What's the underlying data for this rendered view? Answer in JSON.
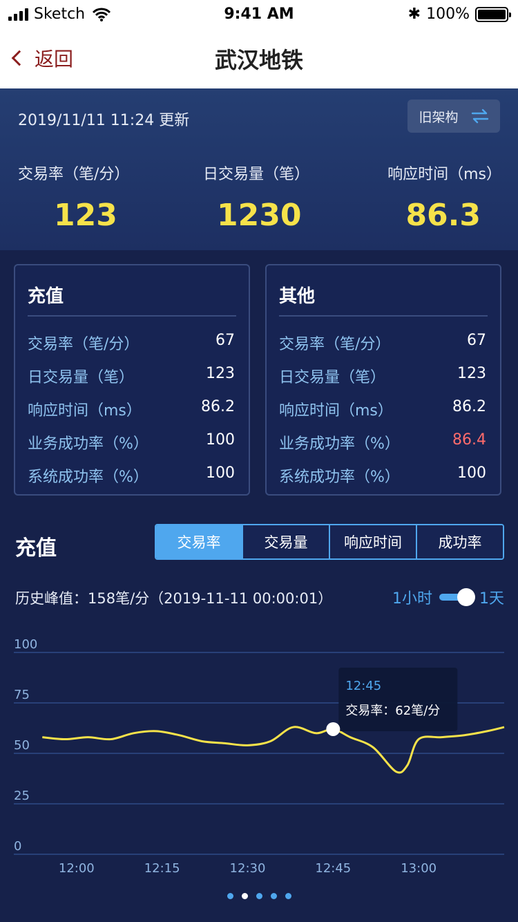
{
  "status_bar": {
    "carrier": "Sketch",
    "time": "9:41 AM",
    "battery": "100%"
  },
  "nav": {
    "back_label": "返回",
    "title": "武汉地铁"
  },
  "summary": {
    "update_text": "2019/11/11   11:24   更新",
    "arch_button_label": "旧架构",
    "metrics": [
      {
        "label": "交易率（笔/分）",
        "value": "123"
      },
      {
        "label": "日交易量（笔）",
        "value": "1230"
      },
      {
        "label": "响应时间（ms）",
        "value": "86.3"
      }
    ]
  },
  "cards": [
    {
      "title": "充值",
      "rows": [
        {
          "label": "交易率（笔/分）",
          "value": "67"
        },
        {
          "label": "日交易量（笔）",
          "value": "123"
        },
        {
          "label": "响应时间（ms）",
          "value": "86.2"
        },
        {
          "label": "业务成功率（%）",
          "value": "100"
        },
        {
          "label": "系统成功率（%）",
          "value": "100"
        }
      ]
    },
    {
      "title": "其他",
      "rows": [
        {
          "label": "交易率（笔/分）",
          "value": "67"
        },
        {
          "label": "日交易量（笔）",
          "value": "123"
        },
        {
          "label": "响应时间（ms）",
          "value": "86.2"
        },
        {
          "label": "业务成功率（%）",
          "value": "86.4"
        },
        {
          "label": "系统成功率（%）",
          "value": "100"
        }
      ]
    }
  ],
  "chart_section": {
    "title": "充值",
    "tabs": [
      "交易率",
      "交易量",
      "响应时间",
      "成功率"
    ],
    "active_tab": 0,
    "peak_text": "历史峰值：158笔/分（2019-11-11 00:00:01）",
    "range_left": "1小时",
    "range_right": "1天",
    "range_selected": "1天",
    "tooltip_time": "12:45",
    "tooltip_text": "交易率：62笔/分"
  },
  "colors": {
    "accent": "#4fa7ee",
    "value_yellow": "#f6e24a",
    "alert_red": "#ff6b6b",
    "line": "#f6e24a"
  },
  "pagination": {
    "count": 5,
    "active": 1
  },
  "chart_data": {
    "type": "line",
    "xlabel": "",
    "ylabel": "",
    "x_ticks": [
      "12:00",
      "12:15",
      "12:30",
      "12:45",
      "13:00"
    ],
    "y_ticks": [
      0,
      25,
      50,
      75,
      100
    ],
    "ylim": [
      0,
      100
    ],
    "grid": true,
    "series": [
      {
        "x": [
          "11:54",
          "11:58",
          "12:02",
          "12:06",
          "12:10",
          "12:14",
          "12:18",
          "12:22",
          "12:26",
          "12:30",
          "12:34",
          "12:38",
          "12:42",
          "12:45",
          "12:48",
          "12:52",
          "12:56",
          "12:58",
          "13:00",
          "13:04",
          "13:08",
          "13:12",
          "13:15"
        ],
        "values": [
          58,
          57,
          58,
          57,
          60,
          61,
          59,
          56,
          55,
          54,
          56,
          63,
          60,
          62,
          58,
          53,
          41,
          44,
          57,
          58,
          59,
          61,
          63
        ]
      }
    ],
    "highlight": {
      "x": "12:45",
      "value": 62
    }
  }
}
